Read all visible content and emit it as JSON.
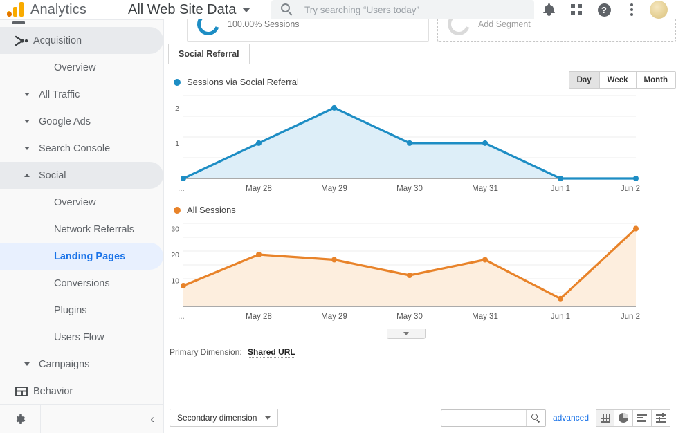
{
  "topbar": {
    "brand": "Analytics",
    "view_name": "All Web Site Data",
    "search_placeholder": "Try searching “Users today”",
    "icons": [
      "bell-icon",
      "apps-grid-icon",
      "help-icon",
      "kebab-menu-icon",
      "avatar"
    ]
  },
  "sidebar": {
    "section": {
      "label": "Acquisition",
      "icon": "acquisition-icon"
    },
    "items": [
      {
        "label": "Overview",
        "level": 2,
        "state": "normal",
        "arrow": "none"
      },
      {
        "label": "All Traffic",
        "level": 1,
        "state": "normal",
        "arrow": "down"
      },
      {
        "label": "Google Ads",
        "level": 1,
        "state": "normal",
        "arrow": "down"
      },
      {
        "label": "Search Console",
        "level": 1,
        "state": "normal",
        "arrow": "down"
      },
      {
        "label": "Social",
        "level": 1,
        "state": "expanded",
        "arrow": "up"
      },
      {
        "label": "Overview",
        "level": 2,
        "state": "normal",
        "arrow": "none"
      },
      {
        "label": "Network Referrals",
        "level": 2,
        "state": "normal",
        "arrow": "none"
      },
      {
        "label": "Landing Pages",
        "level": 2,
        "state": "selected",
        "arrow": "none"
      },
      {
        "label": "Conversions",
        "level": 2,
        "state": "normal",
        "arrow": "none"
      },
      {
        "label": "Plugins",
        "level": 2,
        "state": "normal",
        "arrow": "none"
      },
      {
        "label": "Users Flow",
        "level": 2,
        "state": "normal",
        "arrow": "none"
      },
      {
        "label": "Campaigns",
        "level": 1,
        "state": "normal",
        "arrow": "down"
      }
    ],
    "behavior": {
      "label": "Behavior",
      "icon": "behavior-icon"
    },
    "footer": {
      "gear": "settings-gear-icon",
      "collapse": "collapse-chevron-left-icon"
    }
  },
  "segments": [
    {
      "label": "100.00% Sessions",
      "type": "active",
      "color": "#1d8dc4"
    },
    {
      "label": "Add Segment",
      "type": "add",
      "color": "#dadada"
    }
  ],
  "tabs": [
    {
      "label": "Social Referral",
      "active": true
    }
  ],
  "granularity": {
    "options": [
      {
        "label": "Day",
        "active": true
      },
      {
        "label": "Week",
        "active": false
      },
      {
        "label": "Month",
        "active": false
      }
    ]
  },
  "chart_data": [
    {
      "type": "area",
      "title": "Sessions via Social Referral",
      "legend_label": "Sessions via Social Referral",
      "legend_position": "top-left",
      "color": "#1d8dc4",
      "fill": "#ddeef8",
      "categories": [
        "...",
        "May 28",
        "May 29",
        "May 30",
        "May 31",
        "Jun 1",
        "Jun 2"
      ],
      "values": [
        0,
        1,
        2,
        1,
        1,
        0,
        0
      ],
      "yticks": [
        1,
        2
      ],
      "ylim": [
        0,
        2.35
      ],
      "xlabel": "",
      "ylabel": "",
      "grid": true
    },
    {
      "type": "area",
      "title": "All Sessions",
      "legend_label": "All Sessions",
      "legend_position": "top-left",
      "color": "#e8832a",
      "fill": "#fdeede",
      "categories": [
        "...",
        "May 28",
        "May 29",
        "May 30",
        "May 31",
        "Jun 1",
        "Jun 2"
      ],
      "values": [
        8,
        20,
        18,
        12,
        18,
        3,
        30
      ],
      "yticks": [
        10,
        20,
        30
      ],
      "ylim": [
        0,
        32
      ],
      "xlabel": "",
      "ylabel": "",
      "grid": true
    }
  ],
  "expander": {
    "icon": "chevron-down-icon"
  },
  "primary_dimension": {
    "label": "Primary Dimension:",
    "value": "Shared URL"
  },
  "toolbar": {
    "secondary_dimension": "Secondary dimension",
    "search_value": "",
    "search_placeholder": "",
    "advanced_label": "advanced",
    "view_icons": [
      "table-view-icon",
      "pie-view-icon",
      "bar-view-icon",
      "pivot-view-icon"
    ]
  }
}
